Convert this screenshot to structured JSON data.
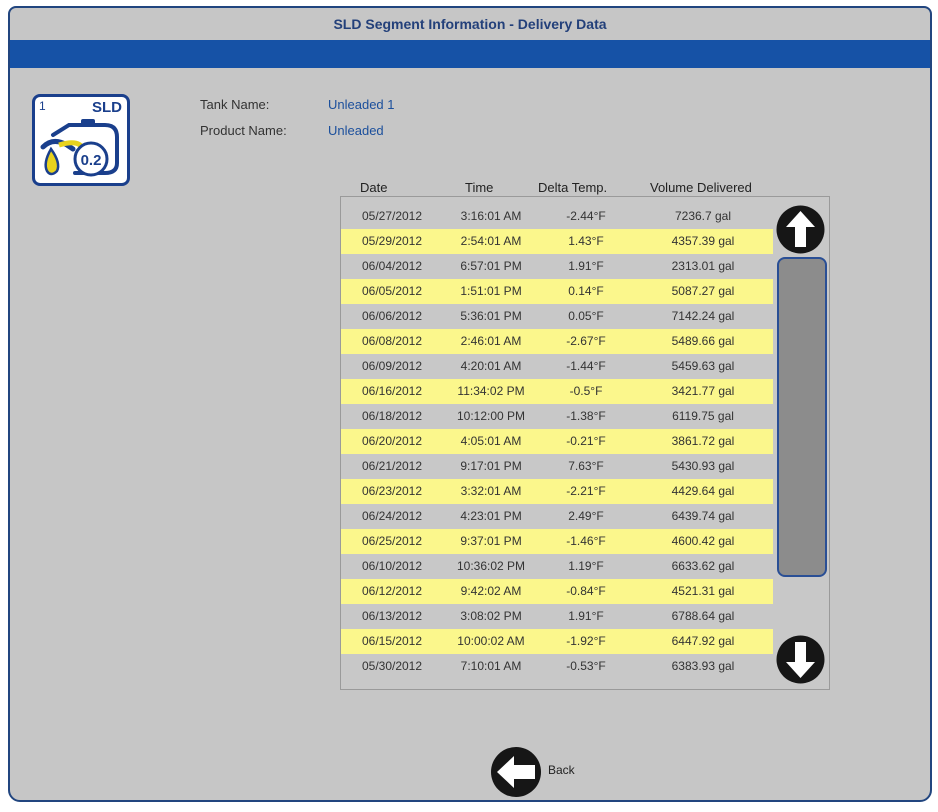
{
  "window": {
    "title": "SLD Segment Information - Delivery Data"
  },
  "icon": {
    "number": "1",
    "label": "SLD",
    "value": "0.2"
  },
  "info": {
    "tank_label": "Tank Name:",
    "tank_value": "Unleaded 1",
    "product_label": "Product Name:",
    "product_value": "Unleaded"
  },
  "table": {
    "headers": [
      "Date",
      "Time",
      "Delta Temp.",
      "Volume Delivered"
    ],
    "rows": [
      [
        "05/27/2012",
        "3:16:01 AM",
        "-2.44°F",
        "7236.7 gal"
      ],
      [
        "05/29/2012",
        "2:54:01 AM",
        "1.43°F",
        "4357.39 gal"
      ],
      [
        "06/04/2012",
        "6:57:01 PM",
        "1.91°F",
        "2313.01 gal"
      ],
      [
        "06/05/2012",
        "1:51:01 PM",
        "0.14°F",
        "5087.27 gal"
      ],
      [
        "06/06/2012",
        "5:36:01 PM",
        "0.05°F",
        "7142.24 gal"
      ],
      [
        "06/08/2012",
        "2:46:01 AM",
        "-2.67°F",
        "5489.66 gal"
      ],
      [
        "06/09/2012",
        "4:20:01 AM",
        "-1.44°F",
        "5459.63 gal"
      ],
      [
        "06/16/2012",
        "11:34:02 PM",
        "-0.5°F",
        "3421.77 gal"
      ],
      [
        "06/18/2012",
        "10:12:00 PM",
        "-1.38°F",
        "6119.75 gal"
      ],
      [
        "06/20/2012",
        "4:05:01 AM",
        "-0.21°F",
        "3861.72 gal"
      ],
      [
        "06/21/2012",
        "9:17:01 PM",
        "7.63°F",
        "5430.93 gal"
      ],
      [
        "06/23/2012",
        "3:32:01 AM",
        "-2.21°F",
        "4429.64 gal"
      ],
      [
        "06/24/2012",
        "4:23:01 PM",
        "2.49°F",
        "6439.74 gal"
      ],
      [
        "06/25/2012",
        "9:37:01 PM",
        "-1.46°F",
        "4600.42 gal"
      ],
      [
        "06/10/2012",
        "10:36:02 PM",
        "1.19°F",
        "6633.62 gal"
      ],
      [
        "06/12/2012",
        "9:42:02 AM",
        "-0.84°F",
        "4521.31 gal"
      ],
      [
        "06/13/2012",
        "3:08:02 PM",
        "1.91°F",
        "6788.64 gal"
      ],
      [
        "06/15/2012",
        "10:00:02 AM",
        "-1.92°F",
        "6447.92 gal"
      ],
      [
        "05/30/2012",
        "7:10:01 AM",
        "-0.53°F",
        "6383.93 gal"
      ]
    ]
  },
  "buttons": {
    "scroll_up_icon": "arrow-up-circle",
    "scroll_down_icon": "arrow-down-circle",
    "back_icon": "arrow-left-circle",
    "back_label": "Back"
  },
  "colors": {
    "title_bar": "#1652a6",
    "accent": "#1a3f8c",
    "row_highlight": "#fbf78c",
    "background": "#c6c6c6"
  }
}
